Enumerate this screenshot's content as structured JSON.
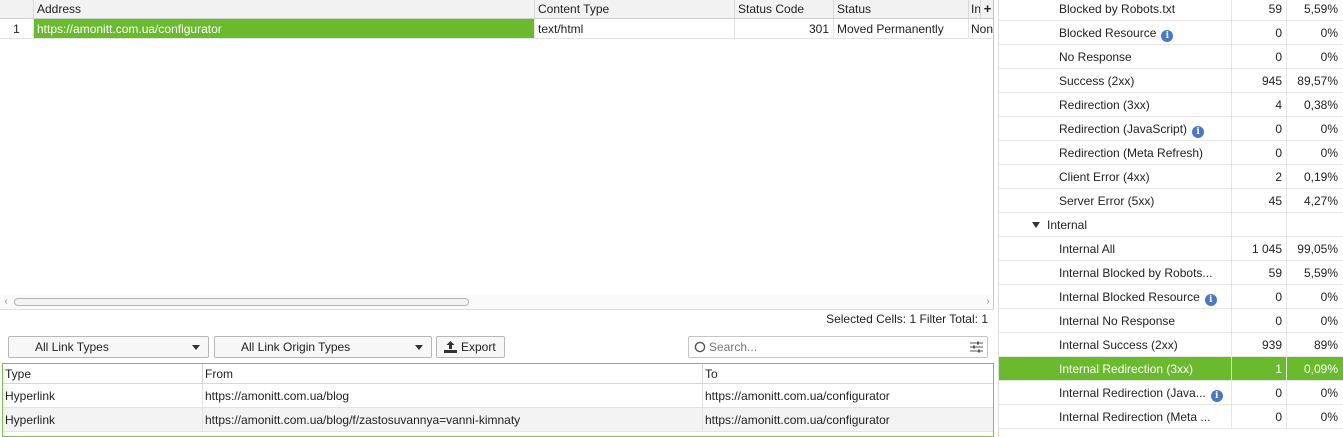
{
  "top_table": {
    "columns": [
      "Address",
      "Content Type",
      "Status Code",
      "Status",
      "In"
    ],
    "more_columns_label": "+",
    "rows": [
      {
        "num": "1",
        "address": "https://amonitt.com.ua/configurator",
        "content_type": "text/html",
        "status_code": "301",
        "status": "Moved Permanently",
        "indexability": "Non"
      }
    ]
  },
  "selection_info": {
    "selected_label": "Selected Cells:",
    "selected_value": "1",
    "filter_label": "Filter Total:",
    "filter_value": "1"
  },
  "toolbar": {
    "link_types": "All Link Types",
    "link_origin_types": "All Link Origin Types",
    "export_label": "Export",
    "search_placeholder": "Search..."
  },
  "bottom_table": {
    "columns": [
      "Type",
      "From",
      "To"
    ],
    "rows": [
      {
        "type": "Hyperlink",
        "from": "https://amonitt.com.ua/blog",
        "to": "https://amonitt.com.ua/configurator"
      },
      {
        "type": "Hyperlink",
        "from": "https://amonitt.com.ua/blog/f/zastosuvannya=vanni-kimnaty",
        "to": "https://amonitt.com.ua/configurator"
      }
    ]
  },
  "overview": {
    "rows": [
      {
        "label": "Blocked by Robots.txt",
        "count": "59",
        "pct": "5,59%",
        "info": false
      },
      {
        "label": "Blocked Resource",
        "count": "0",
        "pct": "0%",
        "info": true
      },
      {
        "label": "No Response",
        "count": "0",
        "pct": "0%",
        "info": false
      },
      {
        "label": "Success (2xx)",
        "count": "945",
        "pct": "89,57%",
        "info": false
      },
      {
        "label": "Redirection (3xx)",
        "count": "4",
        "pct": "0,38%",
        "info": false
      },
      {
        "label": "Redirection (JavaScript)",
        "count": "0",
        "pct": "0%",
        "info": true
      },
      {
        "label": "Redirection (Meta Refresh)",
        "count": "0",
        "pct": "0%",
        "info": false
      },
      {
        "label": "Client Error (4xx)",
        "count": "2",
        "pct": "0,19%",
        "info": false
      },
      {
        "label": "Server Error (5xx)",
        "count": "45",
        "pct": "4,27%",
        "info": false
      }
    ],
    "section_label": "Internal",
    "internal_rows": [
      {
        "label": "Internal All",
        "count": "1 045",
        "pct": "99,05%",
        "info": false
      },
      {
        "label": "Internal Blocked by Robots...",
        "count": "59",
        "pct": "5,59%",
        "info": false
      },
      {
        "label": "Internal Blocked Resource",
        "count": "0",
        "pct": "0%",
        "info": true
      },
      {
        "label": "Internal No Response",
        "count": "0",
        "pct": "0%",
        "info": false
      },
      {
        "label": "Internal Success (2xx)",
        "count": "939",
        "pct": "89%",
        "info": false
      },
      {
        "label": "Internal Redirection (3xx)",
        "count": "1",
        "pct": "0,09%",
        "info": false,
        "selected": true
      },
      {
        "label": "Internal Redirection (Java...",
        "count": "0",
        "pct": "0%",
        "info": true
      },
      {
        "label": "Internal Redirection (Meta ...",
        "count": "0",
        "pct": "0%",
        "info": false
      }
    ]
  },
  "colors": {
    "accent_green": "#6aba2e",
    "info_blue": "#4a78c6"
  }
}
